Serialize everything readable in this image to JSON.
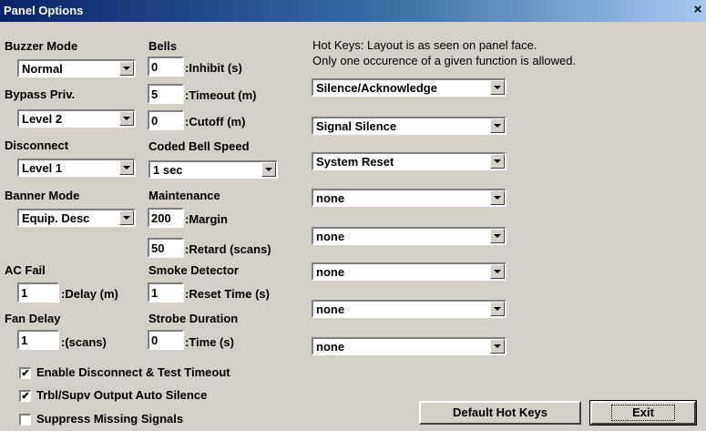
{
  "window": {
    "title": "Panel Options",
    "close": "×"
  },
  "buzzer_mode": {
    "label": "Buzzer Mode",
    "value": "Normal"
  },
  "bypass_priv": {
    "label": "Bypass Priv.",
    "value": "Level 2"
  },
  "disconnect": {
    "label": "Disconnect",
    "value": "Level 1"
  },
  "banner_mode": {
    "label": "Banner Mode",
    "value": "Equip. Desc"
  },
  "ac_fail": {
    "label": "AC Fail",
    "value": "1",
    "unit": ":Delay (m)"
  },
  "fan_delay": {
    "label": "Fan Delay",
    "value": "1",
    "unit": ":(scans)"
  },
  "bells": {
    "label": "Bells",
    "inhibit": {
      "value": "0",
      "unit": ":Inhibit (s)"
    },
    "timeout": {
      "value": "5",
      "unit": ":Timeout (m)"
    },
    "cutoff": {
      "value": "0",
      "unit": ":Cutoff (m)"
    }
  },
  "coded_bell_speed": {
    "label": "Coded Bell Speed",
    "value": "1 sec"
  },
  "maintenance": {
    "label": "Maintenance",
    "margin": {
      "value": "200",
      "unit": ":Margin"
    },
    "retard": {
      "value": "50",
      "unit": ":Retard (scans)"
    }
  },
  "smoke_detector": {
    "label": "Smoke Detector",
    "value": "1",
    "unit": ":Reset Time (s)"
  },
  "strobe_duration": {
    "label": "Strobe Duration",
    "value": "0",
    "unit": ":Time (s)"
  },
  "hotkeys": {
    "line1": "Hot Keys: Layout is as seen on panel face.",
    "line2": "Only one occurence of a given function is allowed.",
    "values": [
      "Silence/Acknowledge",
      "Signal Silence",
      "System Reset",
      "none",
      "none",
      "none",
      "none",
      "none"
    ]
  },
  "options": {
    "enable_disconnect": {
      "label": "Enable Disconnect & Test Timeout",
      "checked": true,
      "mark": "✔"
    },
    "trbl_supv": {
      "label": "Trbl/Supv Output Auto Silence",
      "checked": true,
      "mark": "✔"
    },
    "suppress_missing": {
      "label": "Suppress Missing Signals",
      "checked": false
    }
  },
  "buttons": {
    "default_hot_keys": "Default Hot Keys",
    "exit": "Exit"
  }
}
